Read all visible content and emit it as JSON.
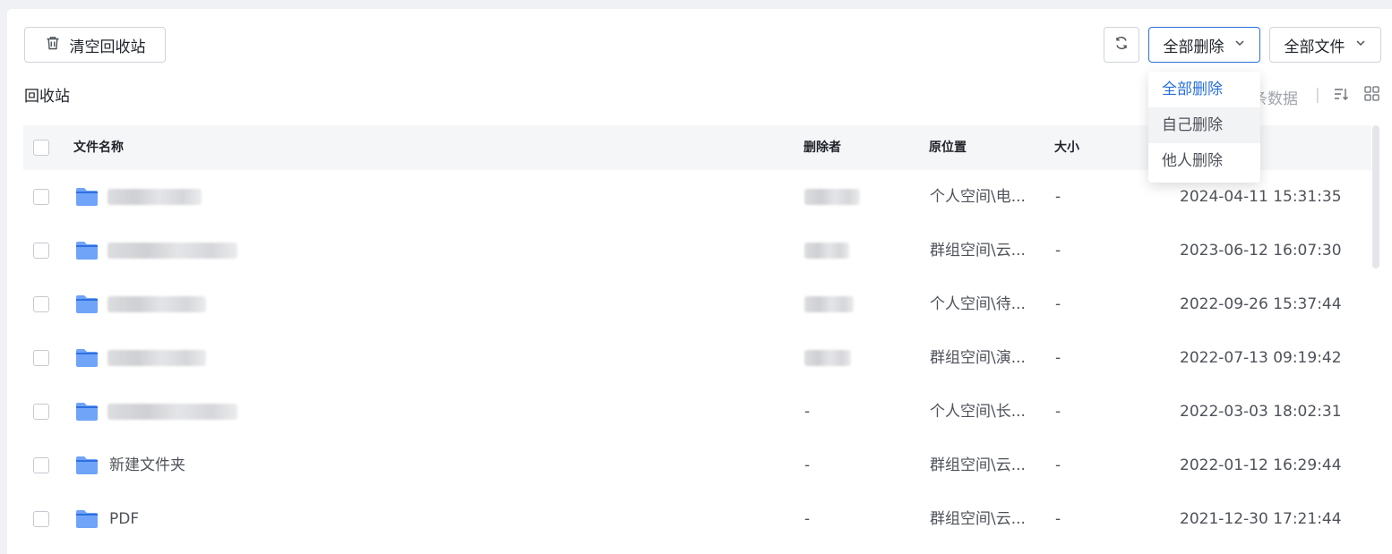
{
  "toolbar": {
    "clear_label": "清空回收站",
    "filter_delete_label": "全部删除",
    "filter_type_label": "全部文件"
  },
  "page_title": "回收站",
  "header_right": {
    "partial_text": "条数据",
    "separator": "|"
  },
  "table": {
    "columns": {
      "name": "文件名称",
      "deleter": "删除者",
      "location": "原位置",
      "size": "大小"
    },
    "rows": [
      {
        "name": "",
        "deleter": "",
        "location": "个人空间\\电...",
        "size": "-",
        "time": "2024-04-11 15:31:35"
      },
      {
        "name": "",
        "deleter": "",
        "location": "群组空间\\云...",
        "size": "-",
        "time": "2023-06-12 16:07:30"
      },
      {
        "name": "",
        "deleter": "",
        "location": "个人空间\\待...",
        "size": "-",
        "time": "2022-09-26 15:37:44"
      },
      {
        "name": "",
        "deleter": "",
        "location": "群组空间\\演...",
        "size": "-",
        "time": "2022-07-13 09:19:42"
      },
      {
        "name": "",
        "deleter": "-",
        "location": "个人空间\\长...",
        "size": "-",
        "time": "2022-03-03 18:02:31"
      },
      {
        "name": "新建文件夹",
        "deleter": "-",
        "location": "群组空间\\云...",
        "size": "-",
        "time": "2022-01-12 16:29:44"
      },
      {
        "name": "PDF",
        "deleter": "-",
        "location": "群组空间\\云...",
        "size": "-",
        "time": "2021-12-30 17:21:44"
      }
    ]
  },
  "dropdown": {
    "options": [
      "全部删除",
      "自己删除",
      "他人删除"
    ],
    "selected": "全部删除"
  },
  "colors": {
    "accent": "#2a6fdb",
    "folder": "#6fa4f8"
  }
}
